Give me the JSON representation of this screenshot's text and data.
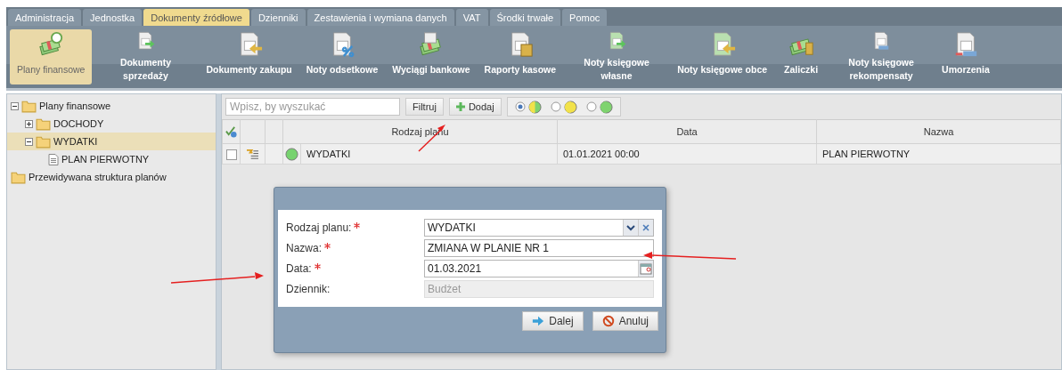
{
  "menu_tabs": [
    {
      "label": "Administracja",
      "selected": false
    },
    {
      "label": "Jednostka",
      "selected": false
    },
    {
      "label": "Dokumenty źródłowe",
      "selected": true
    },
    {
      "label": "Dzienniki",
      "selected": false
    },
    {
      "label": "Zestawienia i wymiana danych",
      "selected": false
    },
    {
      "label": "VAT",
      "selected": false
    },
    {
      "label": "Środki trwałe",
      "selected": false
    },
    {
      "label": "Pomoc",
      "selected": false
    }
  ],
  "toolbar": [
    {
      "label": "Plany finansowe",
      "kind": "money",
      "selected": true
    },
    {
      "label": "Dokumenty sprzedaży",
      "kind": "doc-out",
      "selected": false
    },
    {
      "label": "Dokumenty zakupu",
      "kind": "doc-in",
      "selected": false
    },
    {
      "label": "Noty odsetkowe",
      "kind": "percent",
      "selected": false
    },
    {
      "label": "Wyciągi bankowe",
      "kind": "bank",
      "selected": false
    },
    {
      "label": "Raporty kasowe",
      "kind": "calc",
      "selected": false
    },
    {
      "label": "Noty księgowe własne",
      "kind": "note-out",
      "selected": false
    },
    {
      "label": "Noty księgowe obce",
      "kind": "note-in",
      "selected": false
    },
    {
      "label": "Zaliczki",
      "kind": "coins",
      "selected": false
    },
    {
      "label": "Noty księgowe rekompensaty",
      "kind": "eur",
      "selected": false
    },
    {
      "label": "Umorzenia",
      "kind": "pln",
      "selected": false
    }
  ],
  "tree": [
    {
      "label": "Plany finansowe",
      "kind": "folder",
      "expanded": true,
      "selected": false,
      "children": [
        {
          "label": "DOCHODY",
          "kind": "folder",
          "expanded": false,
          "selected": false
        },
        {
          "label": "WYDATKI",
          "kind": "folder",
          "expanded": true,
          "selected": true,
          "children": [
            {
              "label": "PLAN PIERWOTNY",
              "kind": "document",
              "selected": false
            }
          ]
        }
      ]
    },
    {
      "label": "Przewidywana struktura planów",
      "kind": "folder-plain",
      "selected": false
    }
  ],
  "search": {
    "placeholder": "Wpisz, by wyszukać"
  },
  "filter_button": "Filtruj",
  "add_button": "Dodaj",
  "status_filters": [
    {
      "kind": "mixed",
      "selected": true
    },
    {
      "kind": "pending",
      "selected": false
    },
    {
      "kind": "done",
      "selected": false
    }
  ],
  "table": {
    "columns": [
      "Rodzaj planu",
      "Data",
      "Nazwa"
    ],
    "rows": [
      {
        "checked": false,
        "color": "#77d36f",
        "cells": [
          "WYDATKI",
          "01.01.2021 00:00",
          "PLAN PIERWOTNY"
        ]
      }
    ]
  },
  "dialog": {
    "fields": [
      {
        "label": "Rodzaj planu:",
        "required": true,
        "kind": "select",
        "value": "WYDATKI"
      },
      {
        "label": "Nazwa:",
        "required": true,
        "kind": "text",
        "value": "ZMIANA W PLANIE NR 1"
      },
      {
        "label": "Data:",
        "required": true,
        "kind": "date",
        "value": "01.03.2021"
      },
      {
        "label": "Dziennik:",
        "required": false,
        "kind": "readonly",
        "value": "Budżet"
      }
    ],
    "buttons": [
      {
        "label": "Dalej",
        "kind": "next"
      },
      {
        "label": "Anuluj",
        "kind": "cancel"
      }
    ]
  }
}
